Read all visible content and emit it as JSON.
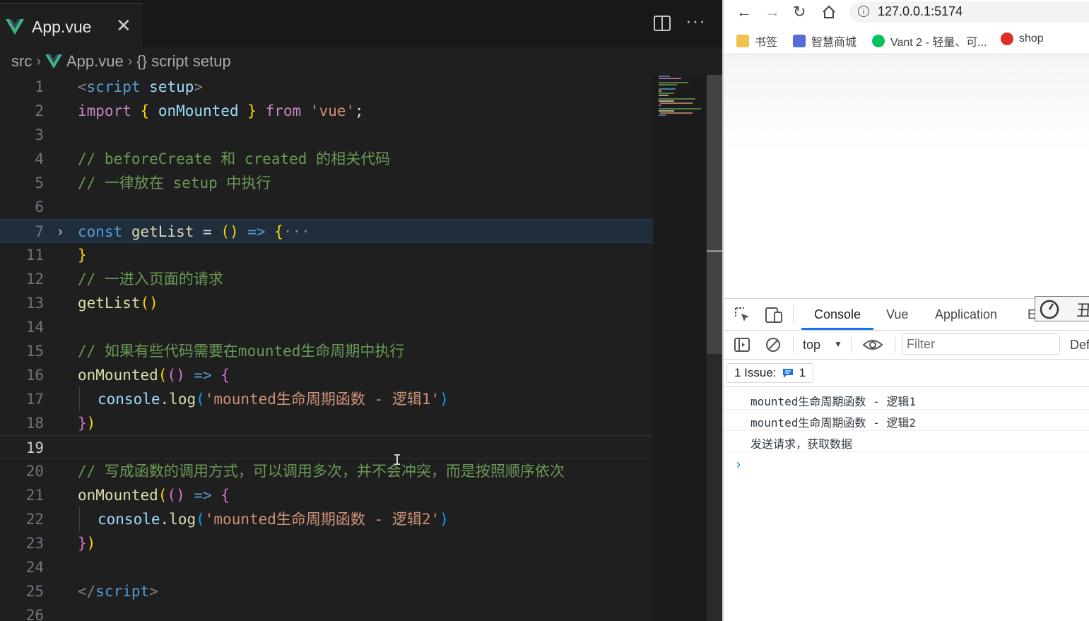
{
  "editor": {
    "tab": {
      "file_name": "App.vue",
      "close_glyph": "✕"
    },
    "more_glyph": "···",
    "breadcrumb": {
      "folder": "src",
      "file": "App.vue",
      "symbol": "{} script setup"
    },
    "lines": [
      {
        "n": "1"
      },
      {
        "n": "2"
      },
      {
        "n": "3"
      },
      {
        "n": "4"
      },
      {
        "n": "5"
      },
      {
        "n": "6"
      },
      {
        "n": "7"
      },
      {
        "n": "11"
      },
      {
        "n": "12"
      },
      {
        "n": "13"
      },
      {
        "n": "14"
      },
      {
        "n": "15"
      },
      {
        "n": "16"
      },
      {
        "n": "17"
      },
      {
        "n": "18"
      },
      {
        "n": "19"
      },
      {
        "n": "20"
      },
      {
        "n": "21"
      },
      {
        "n": "22"
      },
      {
        "n": "23"
      },
      {
        "n": "24"
      },
      {
        "n": "25"
      },
      {
        "n": "26"
      }
    ],
    "code": {
      "l1_tag": "script",
      "l1_attr": "setup",
      "l2_import": "import",
      "l2_name": "onMounted",
      "l2_from": "from",
      "l2_str": "'vue'",
      "l4": "// beforeCreate 和 created 的相关代码",
      "l5": "// 一律放在 setup 中执行",
      "l7_const": "const",
      "l7_name": "getList",
      "l7_rest": " = () => {",
      "l7_dots": "···",
      "l11": "}",
      "l12": "// 一进入页面的请求",
      "l13": "getList",
      "l15": "// 如果有些代码需要在mounted生命周期中执行",
      "l16_fn": "onMounted",
      "l17_obj": "console",
      "l17_fn": "log",
      "l17_str": "'mounted生命周期函数 - 逻辑1'",
      "l20": "// 写成函数的调用方式，可以调用多次，并不会冲突，而是按照顺序依次",
      "l21_fn": "onMounted",
      "l22_obj": "console",
      "l22_fn": "log",
      "l22_str": "'mounted生命周期函数 - 逻辑2'",
      "l25_tag": "script"
    }
  },
  "browser": {
    "url": "127.0.0.1:5174",
    "bookmarks": [
      "书签",
      "智慧商城",
      "Vant 2 - 轻量、可...",
      "shop"
    ],
    "devtools": {
      "tabs": [
        "Console",
        "Vue",
        "Application",
        "E"
      ],
      "active_tab": "Console",
      "perf_label": "丑",
      "context": "top",
      "filter_placeholder": "Filter",
      "levels": "Def",
      "issues_label": "1 Issue:",
      "issues_count": "1",
      "messages": [
        "mounted生命周期函数 - 逻辑1",
        "mounted生命周期函数 - 逻辑2",
        "发送请求，获取数据"
      ],
      "prompt": "›"
    }
  },
  "colors": {
    "keyword": "#569cd6",
    "control": "#c586c0",
    "function": "#dcdcaa",
    "variable": "#9cdcfe",
    "string": "#ce9178",
    "comment": "#6a9955",
    "accent": "#1a73e8",
    "vue_green": "#41b883"
  }
}
